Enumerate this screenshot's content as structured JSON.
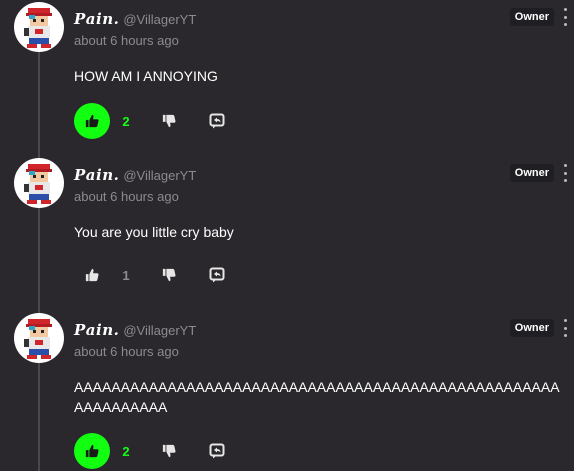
{
  "colors": {
    "background": "#2a282c",
    "accent_green": "#12ff12",
    "muted_text": "#8d8a90",
    "badge_bg": "#1f1e22"
  },
  "comments": [
    {
      "username": "𝑷𝒂𝒊𝒏.",
      "handle": "@VillagerYT",
      "timestamp": "about 6 hours ago",
      "badge": "Owner",
      "text": "HOW AM I ANNOYING",
      "likes": "2",
      "liked": true
    },
    {
      "username": "𝑷𝒂𝒊𝒏.",
      "handle": "@VillagerYT",
      "timestamp": "about 6 hours ago",
      "badge": "Owner",
      "text": "You are you little cry baby",
      "likes": "1",
      "liked": false
    },
    {
      "username": "𝑷𝒂𝒊𝒏.",
      "handle": "@VillagerYT",
      "timestamp": "about 6 hours ago",
      "badge": "Owner",
      "text": "AAAAAAAAAAAAAAAAAAAAAAAAAAAAAAAAAAAAAAAAAAAAAAAAAAAAAAAAAAAAAA",
      "likes": "2",
      "liked": true
    }
  ],
  "icons": {
    "like": "thumbs-up-icon",
    "dislike": "thumbs-down-icon",
    "reply": "reply-icon",
    "menu": "kebab-menu-icon"
  }
}
